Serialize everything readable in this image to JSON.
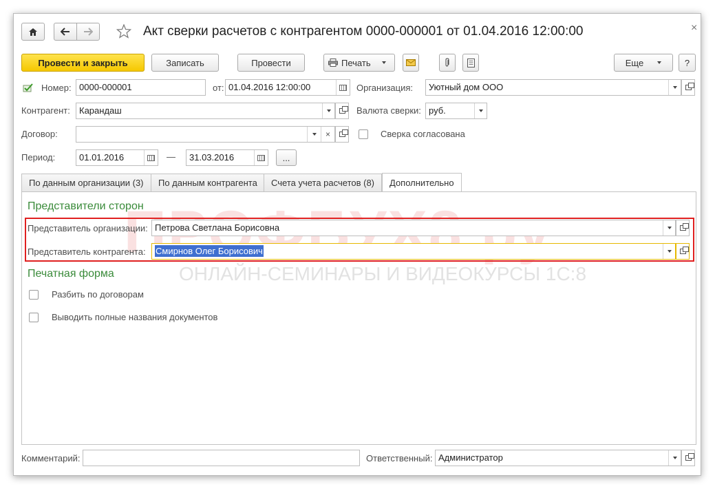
{
  "window": {
    "title": "Акт сверки расчетов с контрагентом 0000-000001 от 01.04.2016 12:00:00",
    "close": "×"
  },
  "toolbar": {
    "post_close": "Провести и закрыть",
    "save": "Записать",
    "post": "Провести",
    "print": "Печать",
    "more": "Еще",
    "help": "?"
  },
  "header": {
    "number_label": "Номер:",
    "number_value": "0000-000001",
    "date_label": "от:",
    "date_value": "01.04.2016 12:00:00",
    "org_label": "Организация:",
    "org_value": "Уютный дом ООО",
    "contractor_label": "Контрагент:",
    "contractor_value": "Карандаш",
    "currency_label": "Валюта сверки:",
    "currency_value": "руб.",
    "contract_label": "Договор:",
    "contract_value": "",
    "agreed_label": "Сверка согласована",
    "period_label": "Период:",
    "period_from": "01.01.2016",
    "period_dash": "—",
    "period_to": "31.03.2016",
    "period_more": "..."
  },
  "tabs": [
    {
      "label": "По данным организации (3)"
    },
    {
      "label": "По данным контрагента"
    },
    {
      "label": "Счета учета расчетов (8)"
    },
    {
      "label": "Дополнительно"
    }
  ],
  "content": {
    "reps_title": "Представители сторон",
    "org_rep_label": "Представитель организации:",
    "org_rep_value": "Петрова Светлана Борисовна",
    "contr_rep_label": "Представитель контрагента:",
    "contr_rep_value": "Смирнов Олег Борисович",
    "print_title": "Печатная форма",
    "split_label": "Разбить по договорам",
    "full_names_label": "Выводить полные названия документов"
  },
  "watermark": {
    "big": "ПРОФБУХ8.ру",
    "small": "ОНЛАЙН-СЕМИНАРЫ И ВИДЕОКУРСЫ 1С:8"
  },
  "footer": {
    "comment_label": "Комментарий:",
    "comment_value": "",
    "responsible_label": "Ответственный:",
    "responsible_value": "Администратор"
  },
  "colors": {
    "accent_yellow": "#f5c800",
    "section_green": "#3a8b3a",
    "highlight_red": "#e02020",
    "selection_blue": "#3f6fd0"
  }
}
